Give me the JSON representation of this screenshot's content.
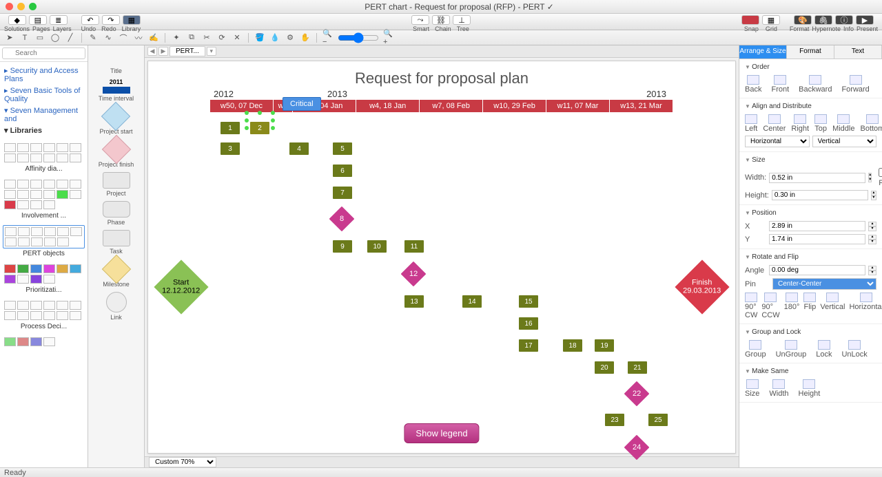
{
  "window": {
    "title": "PERT chart - Request for proposal (RFP) - PERT ✓"
  },
  "toolbar1": {
    "solutions": "Solutions",
    "pages": "Pages",
    "layers": "Layers",
    "undo": "Undo",
    "redo": "Redo",
    "library": "Library",
    "smart": "Smart",
    "chain": "Chain",
    "tree": "Tree",
    "snap": "Snap",
    "grid": "Grid",
    "format": "Format",
    "hypernote": "Hypernote",
    "info": "Info",
    "present": "Present"
  },
  "search": {
    "placeholder": "Search"
  },
  "tree": {
    "items": [
      "Security and Access Plans",
      "Seven Basic Tools of Quality",
      "Seven Management and"
    ],
    "libraries": "Libraries"
  },
  "libs": {
    "affinity": "Affinity dia...",
    "involvement": "Involvement ...",
    "pert": "PERT objects",
    "prior": "Prioritizati...",
    "process": "Process Deci..."
  },
  "shapes": {
    "title": "Title",
    "interval_year": "2011",
    "interval": "Time interval",
    "pstart": "Project start",
    "pfinish": "Project finish",
    "project": "Project",
    "phase": "Phase",
    "task": "Task",
    "milestone": "Milestone",
    "link": "Link"
  },
  "tabs": {
    "tab1": "PERT..."
  },
  "chart": {
    "title": "Request for proposal plan",
    "y2012": "2012",
    "y2013": "2013",
    "y2013b": "2013",
    "weeks": [
      "w50, 07 Dec",
      "w5",
      "w2, 04 Jan",
      "w4, 18 Jan",
      "w7, 08 Feb",
      "w10, 29 Feb",
      "w11, 07 Mar",
      "w13, 21 Mar"
    ],
    "tooltip": "Critical",
    "start_label": "Start",
    "start_date": "12.12.2012",
    "finish_label": "Finish",
    "finish_date": "29.03.2013",
    "legend_btn": "Show legend",
    "nodes": {
      "1": "1",
      "2": "2",
      "3": "3",
      "4": "4",
      "5": "5",
      "6": "6",
      "7": "7",
      "8": "8",
      "9": "9",
      "10": "10",
      "11": "11",
      "12": "12",
      "13": "13",
      "14": "14",
      "15": "15",
      "16": "16",
      "17": "17",
      "18": "18",
      "19": "19",
      "20": "20",
      "21": "21",
      "22": "22",
      "23": "23",
      "24": "24",
      "25": "25"
    }
  },
  "zoom": "Custom 70%",
  "right": {
    "tabs": {
      "arrange": "Arrange & Size",
      "format": "Format",
      "text": "Text"
    },
    "order": {
      "head": "Order",
      "back": "Back",
      "front": "Front",
      "backward": "Backward",
      "forward": "Forward"
    },
    "align": {
      "head": "Align and Distribute",
      "left": "Left",
      "center": "Center",
      "right": "Right",
      "top": "Top",
      "middle": "Middle",
      "bottom": "Bottom",
      "horizontal": "Horizontal",
      "vertical": "Vertical"
    },
    "size": {
      "head": "Size",
      "width_l": "Width:",
      "width_v": "0.52 in",
      "height_l": "Height:",
      "height_v": "0.30 in",
      "lock": "Lock Proportions"
    },
    "position": {
      "head": "Position",
      "x_l": "X",
      "x_v": "2.89 in",
      "y_l": "Y",
      "y_v": "1.74 in"
    },
    "rotate": {
      "head": "Rotate and Flip",
      "angle_l": "Angle",
      "angle_v": "0.00 deg",
      "pin_l": "Pin",
      "pin_v": "Center-Center",
      "cw": "90° CW",
      "ccw": "90° CCW",
      "r180": "180°",
      "flip": "Flip",
      "vert": "Vertical",
      "horiz": "Horizontal"
    },
    "group": {
      "head": "Group and Lock",
      "group": "Group",
      "ungroup": "UnGroup",
      "lock": "Lock",
      "unlock": "UnLock"
    },
    "same": {
      "head": "Make Same",
      "size": "Size",
      "width": "Width",
      "height": "Height"
    }
  },
  "status": "Ready",
  "chart_data": {
    "type": "gantt-pert",
    "title": "Request for proposal plan",
    "timeline": {
      "years": [
        2012,
        2013
      ],
      "weeks": [
        {
          "label": "w50, 07 Dec",
          "year": 2012
        },
        {
          "label": "w52",
          "year": 2012
        },
        {
          "label": "w2, 04 Jan",
          "year": 2013
        },
        {
          "label": "w4, 18 Jan",
          "year": 2013
        },
        {
          "label": "w7, 08 Feb",
          "year": 2013
        },
        {
          "label": "w10, 29 Feb",
          "year": 2013
        },
        {
          "label": "w11, 07 Mar",
          "year": 2013
        },
        {
          "label": "w13, 21 Mar",
          "year": 2013
        }
      ]
    },
    "start": {
      "label": "Start",
      "date": "12.12.2012"
    },
    "finish": {
      "label": "Finish",
      "date": "29.03.2013"
    },
    "tasks": [
      {
        "id": 1,
        "week": "w50"
      },
      {
        "id": 2,
        "week": "w52",
        "selected": true,
        "critical": true
      },
      {
        "id": 3,
        "week": "w50"
      },
      {
        "id": 4,
        "week": "w52"
      },
      {
        "id": 5,
        "week": "w2"
      },
      {
        "id": 6,
        "week": "w2"
      },
      {
        "id": 7,
        "week": "w2"
      },
      {
        "id": 8,
        "week": "w2",
        "milestone": true
      },
      {
        "id": 9,
        "week": "w2"
      },
      {
        "id": 10,
        "week": "w4"
      },
      {
        "id": 11,
        "week": "w4"
      },
      {
        "id": 12,
        "week": "w4",
        "milestone": true
      },
      {
        "id": 13,
        "week": "w4"
      },
      {
        "id": 14,
        "week": "w7"
      },
      {
        "id": 15,
        "week": "w10"
      },
      {
        "id": 16,
        "week": "w10"
      },
      {
        "id": 17,
        "week": "w10"
      },
      {
        "id": 18,
        "week": "w11"
      },
      {
        "id": 19,
        "week": "w13"
      },
      {
        "id": 20,
        "week": "w13"
      },
      {
        "id": 21,
        "week": "w13"
      },
      {
        "id": 22,
        "week": "w13",
        "milestone": true
      },
      {
        "id": 23,
        "week": "w13"
      },
      {
        "id": 24,
        "week": "w13",
        "milestone": true
      },
      {
        "id": 25,
        "week": "w13"
      }
    ]
  }
}
